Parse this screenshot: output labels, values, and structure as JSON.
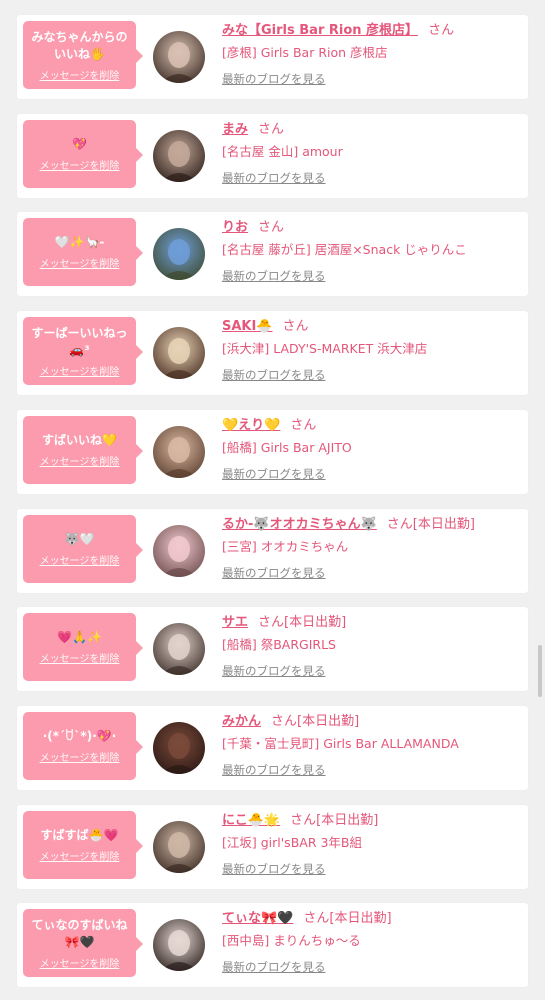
{
  "items": [
    {
      "message": "みなちゃんからのいいね🖐",
      "delete_label": "メッセージを削除",
      "name": "みな【Girls Bar Rion 彦根店】",
      "suffix": "さん",
      "today": "",
      "shop": "[彦根] Girls Bar Rion 彦根店",
      "blog_label": "最新のブログを見る",
      "avatar_colors": [
        "#d9c1b3",
        "#3a2a22"
      ]
    },
    {
      "message": "💖",
      "delete_label": "メッセージを削除",
      "name": "まみ",
      "suffix": "さん",
      "today": "",
      "shop": "[名古屋 金山] amour",
      "blog_label": "最新のブログを見る",
      "avatar_colors": [
        "#c4a99a",
        "#2b1d18"
      ]
    },
    {
      "message": "🤍✨🦙-",
      "delete_label": "メッセージを削除",
      "name": "りお",
      "suffix": "さん",
      "today": "",
      "shop": "[名古屋 藤が丘] 居酒屋×Snack じゃりんこ",
      "blog_label": "最新のブログを見る",
      "avatar_colors": [
        "#6f9ed8",
        "#3d4a2e"
      ]
    },
    {
      "message": "すーぱーいいねっ🚗³",
      "delete_label": "メッセージを削除",
      "name": "SAKI🐣",
      "suffix": "さん",
      "today": "",
      "shop": "[浜大津] LADY'S-MARKET 浜大津店",
      "blog_label": "最新のブログを見る",
      "avatar_colors": [
        "#e8d3b6",
        "#4a2f22"
      ]
    },
    {
      "message": "すばいいね💛",
      "delete_label": "メッセージを削除",
      "name": "💛えり💛",
      "suffix": "さん",
      "today": "",
      "shop": "[船橋] Girls Bar AJITO",
      "blog_label": "最新のブログを見る",
      "avatar_colors": [
        "#d9b9a4",
        "#5a3d2c"
      ]
    },
    {
      "message": "🐺🤍",
      "delete_label": "メッセージを削除",
      "name": "るか-🐺オオカミちゃん🐺",
      "suffix": "さん",
      "today": "[本日出勤]",
      "shop": "[三宮] オオカミちゃん",
      "blog_label": "最新のブログを見る",
      "avatar_colors": [
        "#f1c9cf",
        "#6b4a4a"
      ]
    },
    {
      "message": "💗🙏✨",
      "delete_label": "メッセージを削除",
      "name": "サエ",
      "suffix": "さん",
      "today": "[本日出勤]",
      "shop": "[船橋] 祭BARGIRLS",
      "blog_label": "最新のブログを見る",
      "avatar_colors": [
        "#e2d4cc",
        "#3a2c26"
      ]
    },
    {
      "message": "·(*´ꇴ`*)·💖·",
      "delete_label": "メッセージを削除",
      "name": "みかん",
      "suffix": "さん",
      "today": "[本日出勤]",
      "shop": "[千葉・富士見町] Girls Bar ALLAMANDA",
      "blog_label": "最新のブログを見る",
      "avatar_colors": [
        "#7a4a3a",
        "#2a1814"
      ]
    },
    {
      "message": "すばすば🐣💗",
      "delete_label": "メッセージを削除",
      "name": "にこ🐣🌟",
      "suffix": "さん",
      "today": "[本日出勤]",
      "shop": "[江坂] girl'sBAR 3年B組",
      "blog_label": "最新のブログを見る",
      "avatar_colors": [
        "#cfb7a6",
        "#3a2a22"
      ]
    },
    {
      "message": "てぃなのすばいね🎀🖤",
      "delete_label": "メッセージを削除",
      "name": "てぃな🎀🖤",
      "suffix": "さん",
      "today": "[本日出勤]",
      "shop": "[西中島] まりんちゅ〜る",
      "blog_label": "最新のブログを見る",
      "avatar_colors": [
        "#e6d9d3",
        "#2a1e1c"
      ]
    }
  ]
}
